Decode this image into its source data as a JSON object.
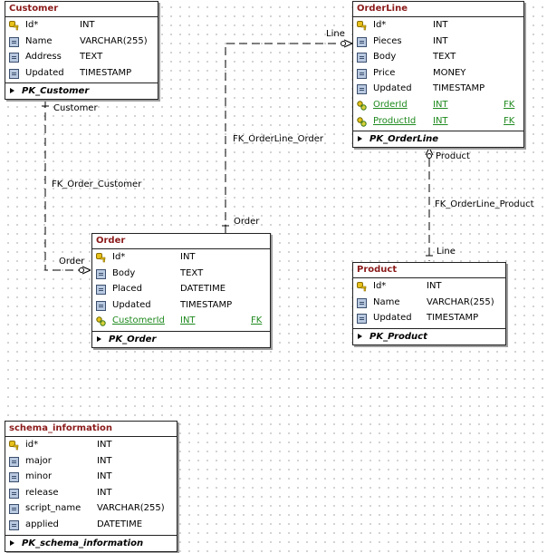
{
  "entities": {
    "customer": {
      "title": "Customer",
      "columns": [
        {
          "name": "Id*",
          "type": "INT",
          "icon": "key-icon"
        },
        {
          "name": "Name",
          "type": "VARCHAR(255)",
          "icon": "column-icon"
        },
        {
          "name": "Address",
          "type": "TEXT",
          "icon": "column-icon"
        },
        {
          "name": "Updated",
          "type": "TIMESTAMP",
          "icon": "column-icon"
        }
      ],
      "pk": "PK_Customer"
    },
    "orderline": {
      "title": "OrderLine",
      "columns": [
        {
          "name": "Id*",
          "type": "INT",
          "icon": "key-icon"
        },
        {
          "name": "Pieces",
          "type": "INT",
          "icon": "column-icon"
        },
        {
          "name": "Body",
          "type": "TEXT",
          "icon": "column-icon"
        },
        {
          "name": "Price",
          "type": "MONEY",
          "icon": "column-icon"
        },
        {
          "name": "Updated",
          "type": "TIMESTAMP",
          "icon": "column-icon"
        },
        {
          "name": "OrderId",
          "type": "INT",
          "icon": "foreign-key-icon",
          "fk": "FK"
        },
        {
          "name": "ProductId",
          "type": "INT",
          "icon": "foreign-key-icon",
          "fk": "FK"
        }
      ],
      "pk": "PK_OrderLine"
    },
    "order": {
      "title": "Order",
      "columns": [
        {
          "name": "Id*",
          "type": "INT",
          "icon": "key-icon"
        },
        {
          "name": "Body",
          "type": "TEXT",
          "icon": "column-icon"
        },
        {
          "name": "Placed",
          "type": "DATETIME",
          "icon": "column-icon"
        },
        {
          "name": "Updated",
          "type": "TIMESTAMP",
          "icon": "column-icon"
        },
        {
          "name": "CustomerId",
          "type": "INT",
          "icon": "foreign-key-icon",
          "fk": "FK"
        }
      ],
      "pk": "PK_Order"
    },
    "product": {
      "title": "Product",
      "columns": [
        {
          "name": "Id*",
          "type": "INT",
          "icon": "key-icon"
        },
        {
          "name": "Name",
          "type": "VARCHAR(255)",
          "icon": "column-icon"
        },
        {
          "name": "Updated",
          "type": "TIMESTAMP",
          "icon": "column-icon"
        }
      ],
      "pk": "PK_Product"
    },
    "schema_information": {
      "title": "schema_information",
      "columns": [
        {
          "name": "id*",
          "type": "INT",
          "icon": "key-icon"
        },
        {
          "name": "major",
          "type": "INT",
          "icon": "column-icon"
        },
        {
          "name": "minor",
          "type": "INT",
          "icon": "column-icon"
        },
        {
          "name": "release",
          "type": "INT",
          "icon": "column-icon"
        },
        {
          "name": "script_name",
          "type": "VARCHAR(255)",
          "icon": "column-icon"
        },
        {
          "name": "applied",
          "type": "DATETIME",
          "icon": "column-icon"
        }
      ],
      "pk": "PK_schema_information"
    }
  },
  "relationships": {
    "fk_order_customer": {
      "name": "FK_Order_Customer",
      "parent_role": "Customer",
      "child_role": "Order"
    },
    "fk_orderline_order": {
      "name": "FK_OrderLine_Order",
      "parent_role": "Order",
      "child_role": "Line"
    },
    "fk_orderline_product": {
      "name": "FK_OrderLine_Product",
      "parent_role": "Product",
      "child_role": "Line"
    }
  },
  "colors": {
    "entity_title": "#8b1a1a",
    "foreign_key_text": "#1f8a1f",
    "key_icon": "#e8c21a",
    "column_icon": "#b9c9e0",
    "grid_dots": "#9a9a9a"
  }
}
